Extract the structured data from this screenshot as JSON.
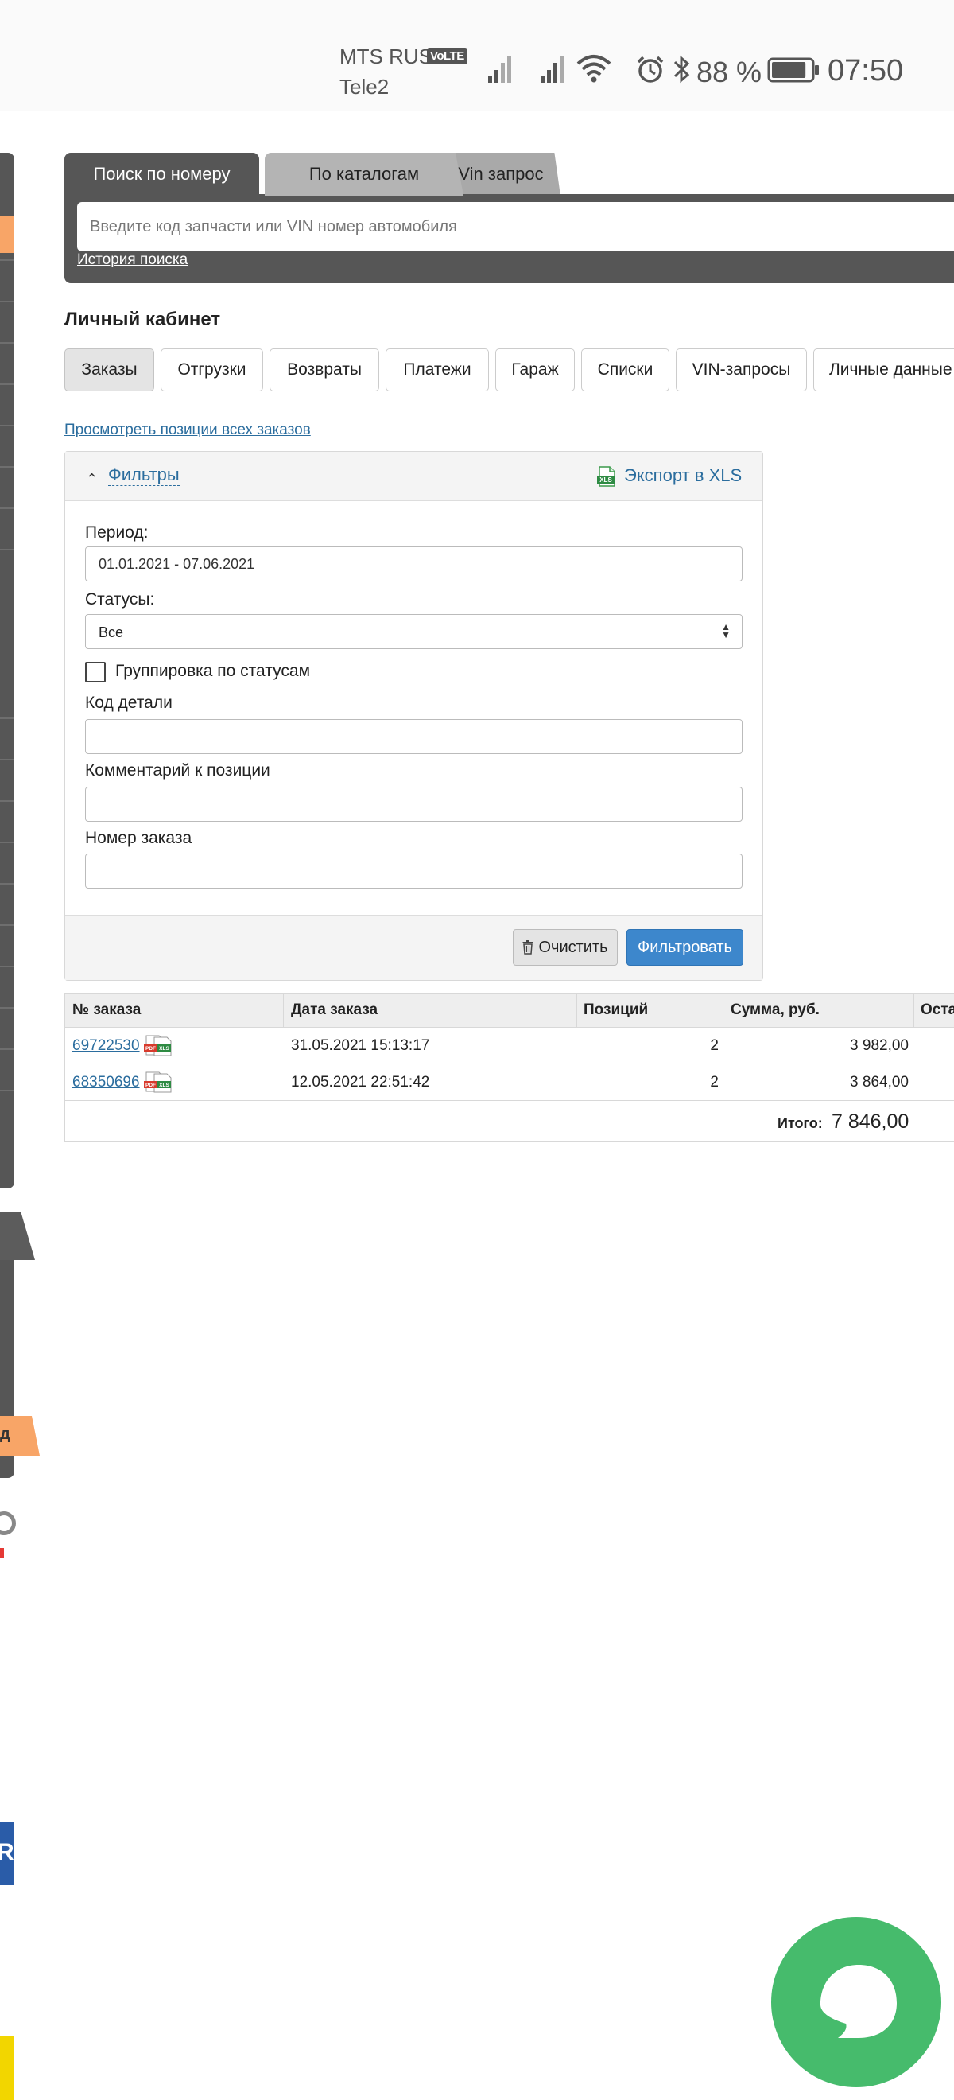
{
  "status_bar": {
    "carrier1": "MTS RUS",
    "volte": "VoLTE",
    "carrier2": "Tele2",
    "battery_text": "88 %",
    "battery_level": 0.88,
    "time": "07:50"
  },
  "search": {
    "tabs": [
      "Поиск по номеру",
      "По каталогам",
      "Vin запрос"
    ],
    "active_tab": 0,
    "placeholder": "Введите код запчасти или VIN номер автомобиля",
    "history_link": "История поиска"
  },
  "cabinet": {
    "title": "Личный кабинет",
    "tabs": [
      "Заказы",
      "Отгрузки",
      "Возвраты",
      "Платежи",
      "Гараж",
      "Списки",
      "VIN-запросы",
      "Личные данные"
    ],
    "active_tab": 0,
    "all_positions_link": "Просмотреть позиции всех заказов"
  },
  "filters": {
    "title": "Фильтры",
    "export_label": "Экспорт в XLS",
    "xls_icon_text": "XLS",
    "period_label": "Период:",
    "period_value": "01.01.2021 - 07.06.2021",
    "statuses_label": "Статусы:",
    "statuses_value": "Все",
    "group_label": "Группировка по статусам",
    "group_checked": false,
    "part_code_label": "Код детали",
    "part_code_value": "",
    "comment_label": "Комментарий к позиции",
    "comment_value": "",
    "order_number_label": "Номер заказа",
    "order_number_value": "",
    "clear_button": "Очистить",
    "filter_button": "Фильтровать"
  },
  "orders": {
    "columns": [
      "№ заказа",
      "Дата заказа",
      "Позиций",
      "Сумма, руб.",
      "Оста"
    ],
    "rows": [
      {
        "number": "69722530",
        "date": "31.05.2021 15:13:17",
        "positions": "2",
        "sum": "3 982,00"
      },
      {
        "number": "68350696",
        "date": "12.05.2021 22:51:42",
        "positions": "2",
        "sum": "3 864,00"
      }
    ],
    "doc_icon_texts": [
      "PDF",
      "XLS"
    ],
    "total_label": "Итого:",
    "total_value": "7 846,00"
  },
  "side": {
    "cropped_letter": "д",
    "cropped_badge": "R"
  },
  "colors": {
    "dark_panel": "#565656",
    "accent_orange": "#f8a567",
    "link_blue": "#2b6d9e",
    "filter_blue": "#3d87cc",
    "chat_green": "#46bb6c"
  }
}
